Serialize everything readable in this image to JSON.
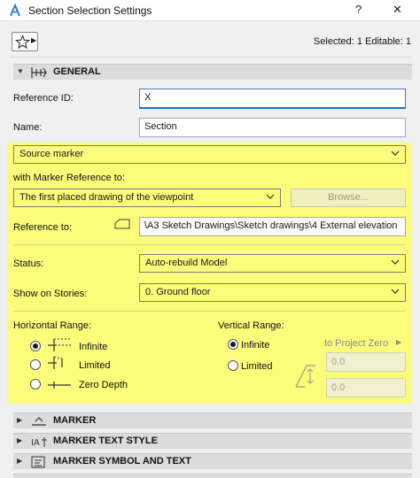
{
  "window": {
    "title": "Section Selection Settings",
    "help": "?",
    "close": "✕"
  },
  "toolbar": {
    "selected_info": "Selected: 1 Editable: 1"
  },
  "general": {
    "header": "GENERAL",
    "reference_id_label": "Reference ID:",
    "reference_id_value": "X",
    "name_label": "Name:",
    "name_value": "Section",
    "marker_type": "Source marker",
    "with_marker_ref_label": "with Marker Reference to:",
    "marker_ref_value": "The first placed drawing of the viewpoint",
    "browse_label": "Browse...",
    "reference_to_label": "Reference to:",
    "reference_to_value": "\\A3 Sketch Drawings\\Sketch drawings\\4 External elevation",
    "status_label": "Status:",
    "status_value": "Auto-rebuild Model",
    "show_on_stories_label": "Show on Stories:",
    "show_on_stories_value": "0. Ground floor",
    "horizontal_range_label": "Horizontal Range:",
    "horizontal_options": [
      "Infinite",
      "Limited",
      "Zero Depth"
    ],
    "horizontal_selected": "Infinite",
    "vertical_range_label": "Vertical Range:",
    "vertical_options": [
      "Infinite",
      "Limited"
    ],
    "vertical_selected": "Infinite",
    "to_project_zero": "to Project Zero",
    "vertical_value_1": "0.0",
    "vertical_value_2": "0.0"
  },
  "sections": [
    {
      "label": "MARKER",
      "icon": "marker-icon"
    },
    {
      "label": "MARKER TEXT STYLE",
      "icon": "text-style-icon"
    },
    {
      "label": "MARKER SYMBOL AND TEXT",
      "icon": "symbol-text-icon"
    }
  ],
  "colors": {
    "highlight": "#fafc7a",
    "focus": "#1f6fd0"
  }
}
